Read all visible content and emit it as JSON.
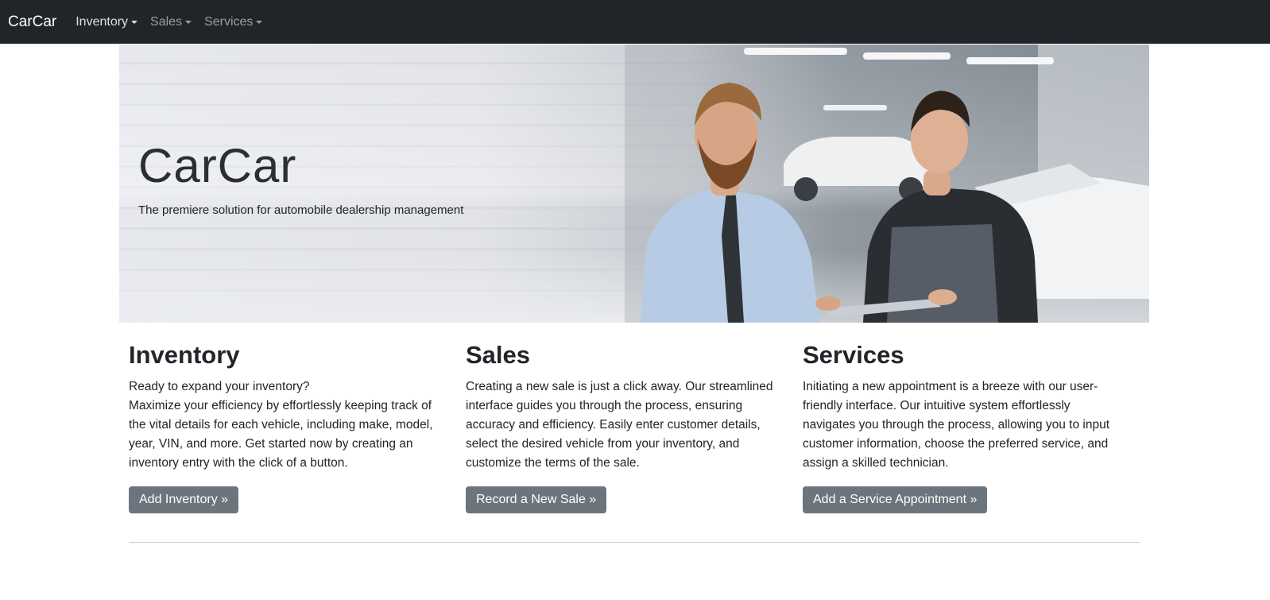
{
  "navbar": {
    "brand": "CarCar",
    "menus": [
      {
        "label": "Inventory"
      },
      {
        "label": "Sales"
      },
      {
        "label": "Services"
      }
    ]
  },
  "hero": {
    "title": "CarCar",
    "subtitle": "The premiere solution for automobile dealership management"
  },
  "sections": [
    {
      "heading": "Inventory",
      "text_lead": "Ready to expand your inventory?",
      "text_body": "Maximize your efficiency by effortlessly keeping track of the vital details for each vehicle, including make, model, year, VIN, and more. Get started now by creating an inventory entry with the click of a button.",
      "button": "Add Inventory »"
    },
    {
      "heading": "Sales",
      "text_body": "Creating a new sale is just a click away. Our streamlined interface guides you through the process, ensuring accuracy and efficiency. Easily enter customer details, select the desired vehicle from your inventory, and customize the terms of the sale.",
      "button": "Record a New Sale »"
    },
    {
      "heading": "Services",
      "text_body": "Initiating a new appointment is a breeze with our user-friendly interface. Our intuitive system effortlessly navigates you through the process, allowing you to input customer information, choose the preferred service, and assign a skilled technician.",
      "button": "Add a Service Appointment »"
    }
  ],
  "colors": {
    "navbar_bg": "#212529",
    "button_bg": "#6c757d",
    "text": "#212529"
  }
}
